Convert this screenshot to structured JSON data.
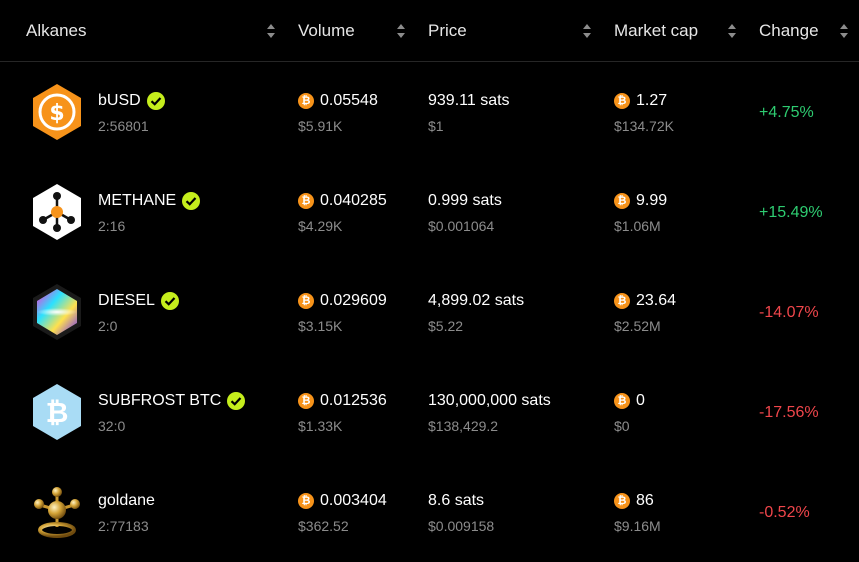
{
  "colors": {
    "background": "#000000",
    "positive": "#2ecc71",
    "negative": "#f0464b",
    "verified": "#c5ee1c",
    "bitcoin": "#f7931a"
  },
  "header": {
    "alkanes": "Alkanes",
    "volume": "Volume",
    "price": "Price",
    "market_cap": "Market cap",
    "change": "Change",
    "sort_icon": "sort-arrows-icon"
  },
  "rows": [
    {
      "name": "bUSD",
      "id": "2:56801",
      "verified": true,
      "logo_icon": "dollar-coin-icon",
      "volume_sats": "0.05548",
      "volume_usd": "$5.91K",
      "price_sats": "939.11 sats",
      "price_usd": "$1",
      "mcap_btc": "1.27",
      "mcap_usd": "$134.72K",
      "change": "+4.75%",
      "direction": "up"
    },
    {
      "name": "METHANE",
      "id": "2:16",
      "verified": true,
      "logo_icon": "molecule-icon",
      "volume_sats": "0.040285",
      "volume_usd": "$4.29K",
      "price_sats": "0.999 sats",
      "price_usd": "$0.001064",
      "mcap_btc": "9.99",
      "mcap_usd": "$1.06M",
      "change": "+15.49%",
      "direction": "up"
    },
    {
      "name": "DIESEL",
      "id": "2:0",
      "verified": true,
      "logo_icon": "prism-icon",
      "volume_sats": "0.029609",
      "volume_usd": "$3.15K",
      "price_sats": "4,899.02 sats",
      "price_usd": "$5.22",
      "mcap_btc": "23.64",
      "mcap_usd": "$2.52M",
      "change": "-14.07%",
      "direction": "down"
    },
    {
      "name": "SUBFROST BTC",
      "id": "32:0",
      "verified": true,
      "logo_icon": "bitcoin-hexagon-icon",
      "volume_sats": "0.012536",
      "volume_usd": "$1.33K",
      "price_sats": "130,000,000 sats",
      "price_usd": "$138,429.2",
      "mcap_btc": "0",
      "mcap_usd": "$0",
      "change": "-17.56%",
      "direction": "down"
    },
    {
      "name": "goldane",
      "id": "2:77183",
      "verified": false,
      "logo_icon": "gold-molecule-icon",
      "volume_sats": "0.003404",
      "volume_usd": "$362.52",
      "price_sats": "8.6 sats",
      "price_usd": "$0.009158",
      "mcap_btc": "86",
      "mcap_usd": "$9.16M",
      "change": "-0.52%",
      "direction": "down"
    }
  ]
}
